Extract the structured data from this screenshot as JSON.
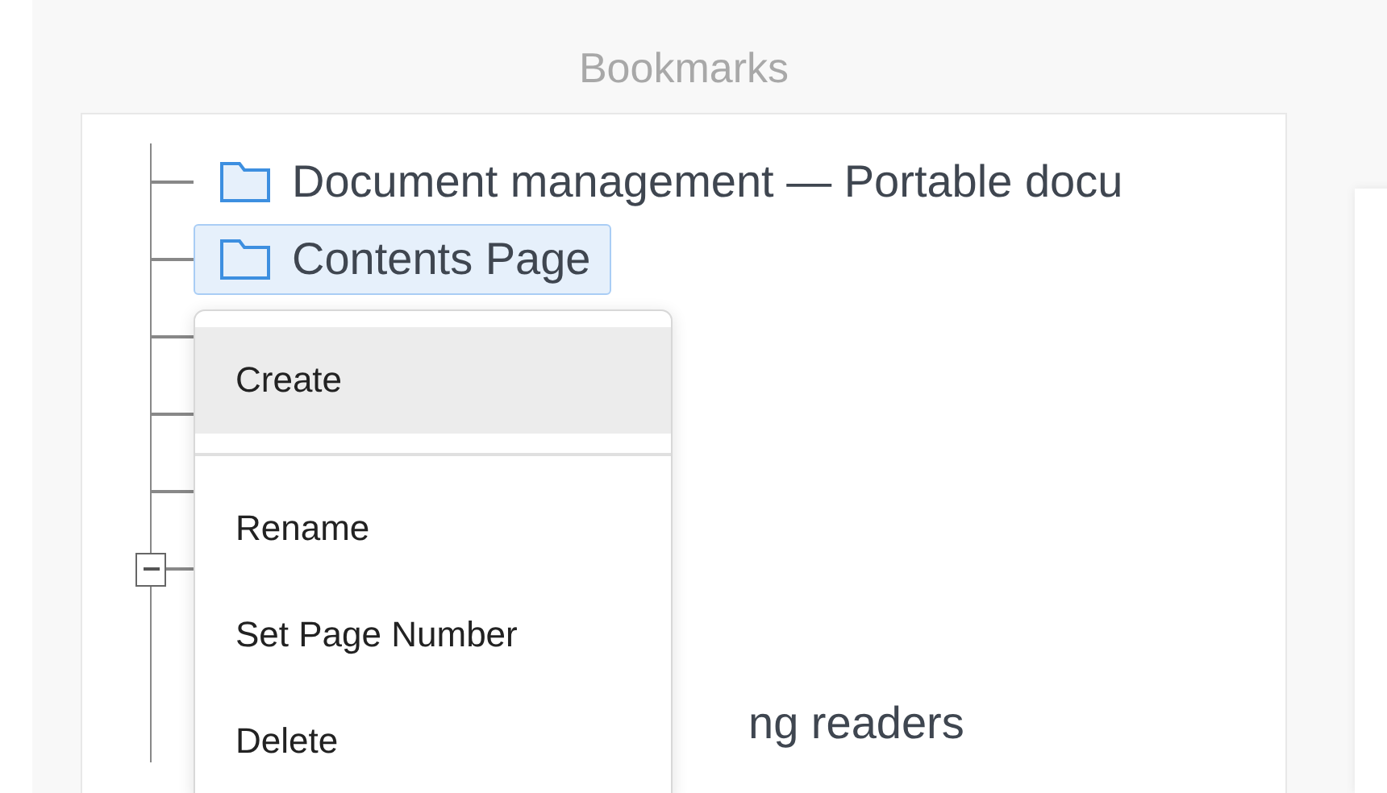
{
  "title": "Bookmarks",
  "tree": [
    {
      "kind": "item",
      "label": "Document management — Portable docu",
      "selected": false
    },
    {
      "kind": "item",
      "label": "Contents Page",
      "selected": true
    },
    {
      "kind": "covered"
    },
    {
      "kind": "covered"
    },
    {
      "kind": "covered"
    },
    {
      "kind": "group",
      "expanded": true,
      "children": [
        {
          "kind": "covered"
        },
        {
          "kind": "item",
          "label": "ng readers",
          "selected": false
        }
      ]
    }
  ],
  "context_menu": [
    {
      "kind": "item",
      "label": "Create",
      "highlighted": true
    },
    {
      "kind": "divider"
    },
    {
      "kind": "item",
      "label": "Rename",
      "highlighted": false
    },
    {
      "kind": "item",
      "label": "Set Page Number",
      "highlighted": false
    },
    {
      "kind": "item",
      "label": "Delete",
      "highlighted": false
    }
  ]
}
